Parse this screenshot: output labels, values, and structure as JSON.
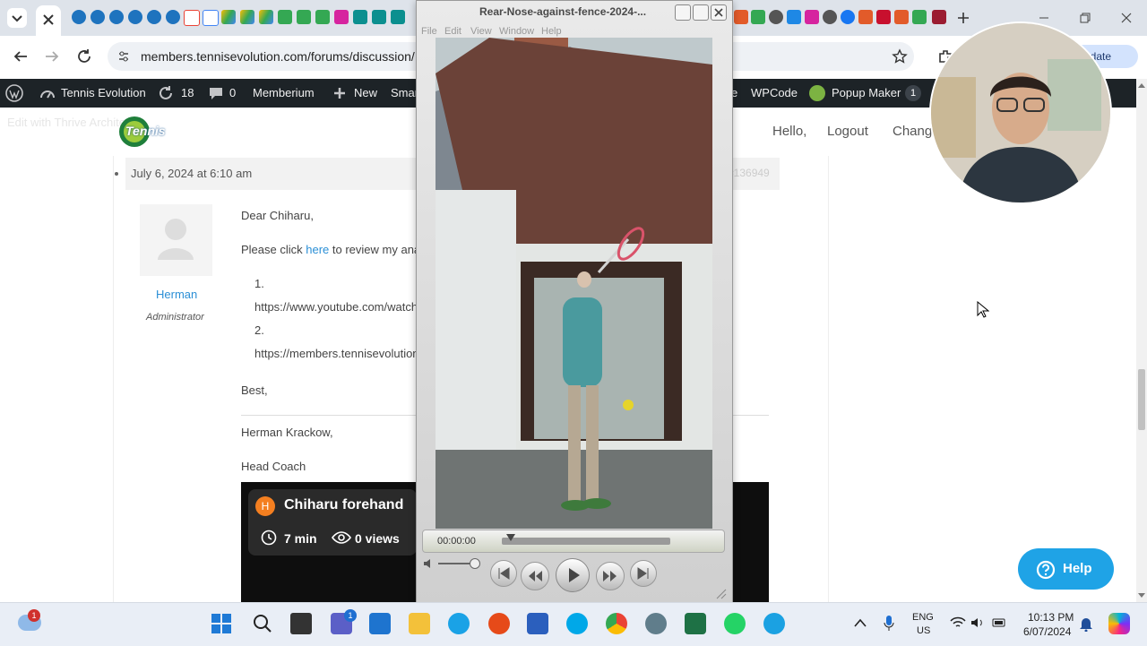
{
  "browser": {
    "url": "members.tennisevolution.com/forums/discussion/",
    "update_label": "pdate"
  },
  "wp_admin_bar": {
    "site_name": "Tennis Evolution",
    "updates_count": "18",
    "comments_count": "0",
    "items": [
      "Memberium",
      "New",
      "Smar",
      "e",
      "WPCode",
      "Popup Maker"
    ],
    "popup_count": "1"
  },
  "header": {
    "overlay_text": "Edit with Thrive Architect",
    "logo_text": "Tennis",
    "nav": [
      "Hello,",
      "Logout",
      "Change"
    ]
  },
  "post": {
    "date": "July 6, 2024 at 6:10 am",
    "post_id": "#136949",
    "author_name": "Herman",
    "author_role": "Administrator",
    "greeting": "Dear Chiharu,",
    "intro_pre": "Please click ",
    "intro_link": "here",
    "intro_post": " to review my analy",
    "list": [
      {
        "num": "1.",
        "link": "https://www.youtube.com/watch"
      },
      {
        "num": "2.",
        "link": "https://members.tennisevolution"
      }
    ],
    "closing": "Best,",
    "signature_name": "Herman Krackow,",
    "signature_title": "Head Coach"
  },
  "video_card": {
    "avatar_letter": "H",
    "title": "Chiharu forehand",
    "duration": "7 min",
    "views": "0 views"
  },
  "quicktime": {
    "title": "Rear-Nose-against-fence-2024-...",
    "menu": [
      "File",
      "Edit",
      "View",
      "Window",
      "Help"
    ],
    "time": "00:00:00",
    "playhead_fraction": 0.03
  },
  "help_button": {
    "label": "Help"
  },
  "taskbar": {
    "weather_badge": "1",
    "teams_badge": "1",
    "lang_line1": "ENG",
    "lang_line2": "US",
    "clock_time": "10:13 PM",
    "clock_date": "6/07/2024"
  },
  "colors": {
    "accent": "#2b8fd6",
    "wpbar": "#1d2327",
    "help": "#1fa3e6"
  }
}
